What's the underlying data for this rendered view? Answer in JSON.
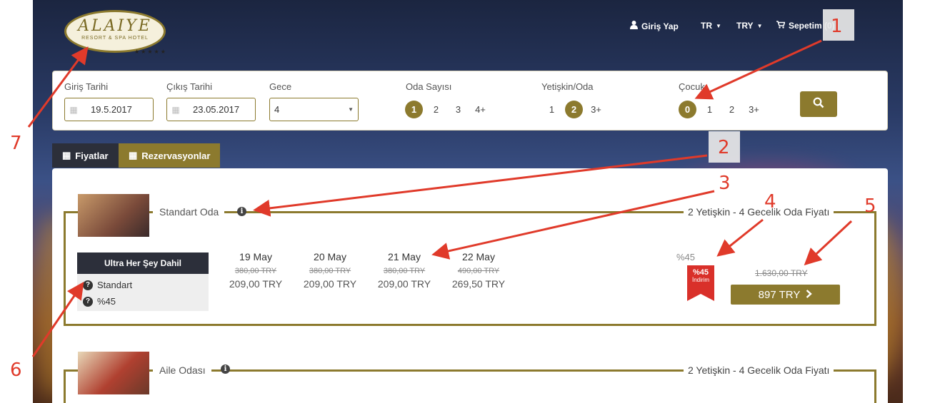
{
  "logo": {
    "brand": "ALAIYE",
    "subtitle": "RESORT & SPA HOTEL",
    "stars": "★★★★★"
  },
  "nav": {
    "login": "Giriş Yap",
    "language": "TR",
    "currency": "TRY",
    "cart": "Sepetim (0)"
  },
  "search": {
    "checkin_label": "Giriş Tarihi",
    "checkin_value": "19.5.2017",
    "checkout_label": "Çıkış Tarihi",
    "checkout_value": "23.05.2017",
    "nights_label": "Gece",
    "nights_value": "4",
    "rooms_label": "Oda Sayısı",
    "rooms_options": [
      "1",
      "2",
      "3",
      "4+"
    ],
    "rooms_selected": "1",
    "adults_label": "Yetişkin/Oda",
    "adults_options": [
      "1",
      "2",
      "3+"
    ],
    "adults_selected": "2",
    "children_label": "Çocuk",
    "children_options": [
      "0",
      "1",
      "2",
      "3+"
    ],
    "children_selected": "0"
  },
  "tabs": {
    "prices": "Fiyatlar",
    "reservations": "Rezervasyonlar"
  },
  "rooms": [
    {
      "name": "Standart Oda",
      "price_label": "2 Yetişkin - 4 Gecelik Oda Fiyatı",
      "plan": {
        "board": "Ultra Her Şey Dahil",
        "rate_name": "Standart",
        "discount": "%45"
      },
      "days": [
        {
          "date": "19 May",
          "old": "380,00 TRY",
          "new": "209,00 TRY"
        },
        {
          "date": "20 May",
          "old": "380,00 TRY",
          "new": "209,00 TRY"
        },
        {
          "date": "21 May",
          "old": "380,00 TRY",
          "new": "209,00 TRY"
        },
        {
          "date": "22 May",
          "old": "490,00 TRY",
          "new": "269,50 TRY"
        }
      ],
      "discount_text": "%45",
      "ribbon_percent": "%45",
      "ribbon_text": "İndirim",
      "old_total": "1.630,00 TRY",
      "book_label": "897 TRY"
    },
    {
      "name": "Aile Odası",
      "price_label": "2 Yetişkin - 4 Gecelik Oda Fiyatı"
    }
  ],
  "annotations": [
    "1",
    "2",
    "3",
    "4",
    "5",
    "6",
    "7"
  ],
  "colors": {
    "accent": "#8c7a2e",
    "dark": "#2c2f3a",
    "ribbon": "#d9302a",
    "arrow": "#e03a2a"
  }
}
